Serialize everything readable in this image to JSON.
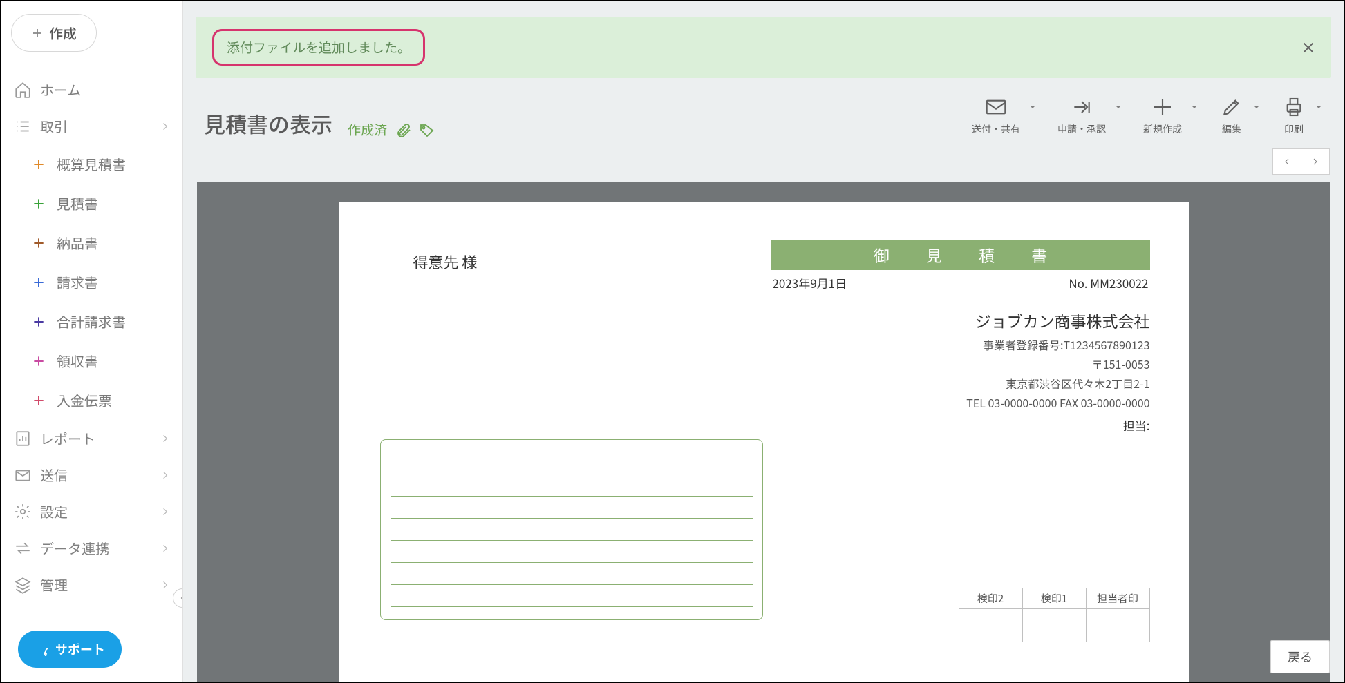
{
  "sidebar": {
    "create_label": "作成",
    "items": [
      {
        "label": "ホーム"
      },
      {
        "label": "取引"
      },
      {
        "label": "レポート"
      },
      {
        "label": "送信"
      },
      {
        "label": "設定"
      },
      {
        "label": "データ連携"
      },
      {
        "label": "管理"
      }
    ],
    "sub_items": [
      {
        "label": "概算見積書",
        "color": "#e08a2a"
      },
      {
        "label": "見積書",
        "color": "#3aa23a"
      },
      {
        "label": "納品書",
        "color": "#a05a2a"
      },
      {
        "label": "請求書",
        "color": "#3a6ad6"
      },
      {
        "label": "合計請求書",
        "color": "#4a3aa2"
      },
      {
        "label": "領収書",
        "color": "#c94aa2"
      },
      {
        "label": "入金伝票",
        "color": "#d14a6a"
      }
    ],
    "support_label": "サポート"
  },
  "alert": {
    "message": "添付ファイルを追加しました。"
  },
  "header": {
    "title": "見積書の表示",
    "status": "作成済"
  },
  "toolbar": {
    "send_label": "送付・共有",
    "apply_label": "申請・承認",
    "new_label": "新規作成",
    "edit_label": "編集",
    "print_label": "印刷"
  },
  "document": {
    "recipient": "得意先 様",
    "banner_title": "御 見 積 書",
    "date": "2023年9月1日",
    "number": "No. MM230022",
    "company_name": "ジョブカン商事株式会社",
    "reg_no": "事業者登録番号:T1234567890123",
    "postal": "〒151-0053",
    "address": "東京都渋谷区代々木2丁目2-1",
    "tel": "TEL 03-0000-0000 FAX 03-0000-0000",
    "tanto": "担当:",
    "stamp_headers": [
      "検印2",
      "検印1",
      "担当者印"
    ]
  },
  "footer": {
    "back_label": "戻る"
  }
}
